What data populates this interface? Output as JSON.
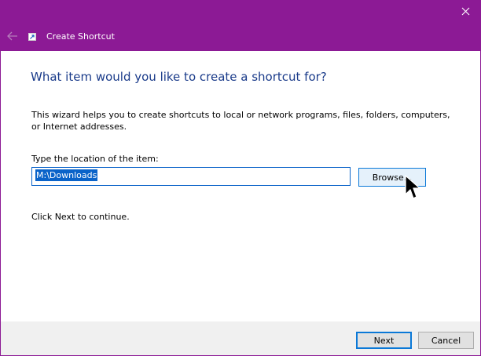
{
  "window": {
    "title": "Create Shortcut",
    "accent_color": "#8c1a95"
  },
  "titlebar": {
    "close_icon": "close-icon",
    "back_icon": "back-arrow-icon",
    "app_icon": "shortcut-icon"
  },
  "main": {
    "heading": "What item would you like to create a shortcut for?",
    "description": "This wizard helps you to create shortcuts to local or network programs, files, folders, computers, or Internet addresses.",
    "location_label": "Type the location of the item:",
    "location_value": "M:\\Downloads",
    "browse_label": "Browse...",
    "continue_text": "Click Next to continue."
  },
  "footer": {
    "next_label": "Next",
    "cancel_label": "Cancel"
  }
}
